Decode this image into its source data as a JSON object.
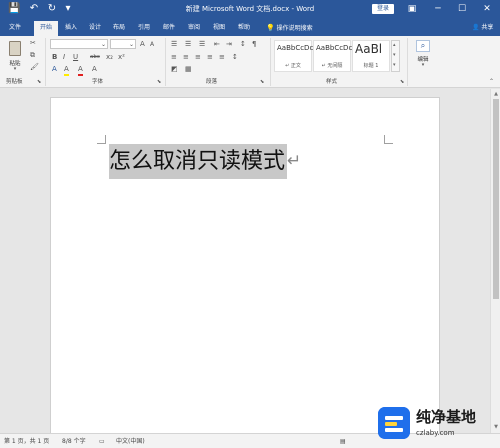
{
  "window": {
    "title": "新建 Microsoft Word 文档.docx - Word",
    "login_label": "登录",
    "controls": {
      "ribbon_options": "▣",
      "minimize": "─",
      "maximize": "☐",
      "close": "✕"
    },
    "quick_access": {
      "save": "💾",
      "undo": "↶",
      "redo": "↻",
      "customize": "▾"
    }
  },
  "tabs": [
    {
      "label": "文件",
      "active": false
    },
    {
      "label": "开始",
      "active": true
    },
    {
      "label": "插入",
      "active": false
    },
    {
      "label": "设计",
      "active": false
    },
    {
      "label": "布局",
      "active": false
    },
    {
      "label": "引用",
      "active": false
    },
    {
      "label": "邮件",
      "active": false
    },
    {
      "label": "审阅",
      "active": false
    },
    {
      "label": "视图",
      "active": false
    },
    {
      "label": "帮助",
      "active": false
    }
  ],
  "tell_me": "操作说明搜索",
  "share_label": "共享",
  "ribbon": {
    "clipboard": {
      "paste_label": "粘贴",
      "group_label": "剪贴板"
    },
    "font": {
      "group_label": "字体",
      "bold": "B",
      "italic": "I",
      "underline": "U",
      "strike": "abc",
      "sub": "x₂",
      "sup": "x²",
      "highlight": "A",
      "color": "A",
      "clear": "A"
    },
    "paragraph": {
      "group_label": "段落"
    },
    "styles": {
      "group_label": "样式",
      "items": [
        {
          "sample": "AaBbCcDc",
          "name": "↵ 正文"
        },
        {
          "sample": "AaBbCcDc",
          "name": "↵ 无间隔"
        },
        {
          "sample": "AaBl",
          "name": "标题 1"
        }
      ]
    },
    "editing": {
      "label": "编辑"
    }
  },
  "document": {
    "text": "怎么取消只读模式",
    "para_mark": "↵"
  },
  "status": {
    "page": "第 1 页，共 1 页",
    "words": "8/8 个字",
    "language": "中文(中国)"
  },
  "watermark": {
    "brand": "纯净基地",
    "url": "czlaby.com"
  },
  "colors": {
    "brand_blue": "#2b579a",
    "selection": "#c8c8c8"
  }
}
